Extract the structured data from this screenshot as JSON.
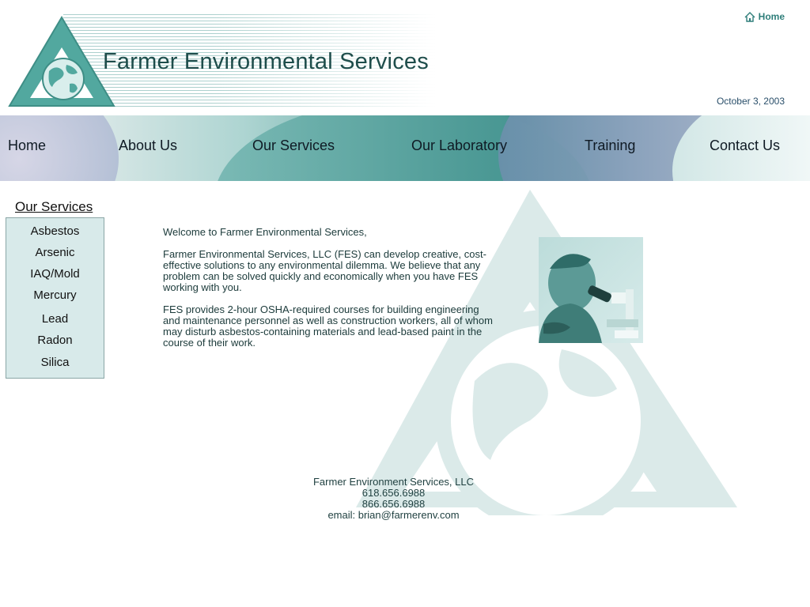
{
  "header": {
    "site_title": "Farmer Environmental Services",
    "home_link": "Home",
    "date": "October 3, 2003"
  },
  "nav": {
    "items": [
      {
        "label": "Home"
      },
      {
        "label": "About Us"
      },
      {
        "label": "Our Services"
      },
      {
        "label": "Our Laboratory"
      },
      {
        "label": "Training"
      },
      {
        "label": "Contact Us"
      }
    ]
  },
  "sidebar": {
    "heading": "Our Services",
    "items": [
      {
        "label": "Asbestos"
      },
      {
        "label": "Arsenic"
      },
      {
        "label": "IAQ/Mold"
      },
      {
        "label": "Mercury"
      },
      {
        "label": "Lead"
      },
      {
        "label": "Radon"
      },
      {
        "label": "Silica"
      }
    ]
  },
  "main": {
    "welcome": "Welcome to Farmer Environmental Services,",
    "paragraph1": "Farmer Environmental Services, LLC (FES) can develop creative, cost-effective solutions to any environmental dilemma. We believe that any problem can be solved quickly and economically when you have FES working with you.",
    "paragraph2": "FES provides 2-hour OSHA-required courses for building engineering and maintenance personnel as well as construction workers, all of whom may disturb asbestos-containing materials and lead-based paint in the course of their work."
  },
  "footer": {
    "company": "Farmer Environment Services, LLC",
    "phone1": "618.656.6988",
    "phone2": "866.656.6988",
    "email": "email: brian@farmerenv.com"
  },
  "colors": {
    "accent": "#3f8f8b",
    "title": "#1e4d4b",
    "sidebar_bg": "#d8eaea"
  },
  "icons": {
    "logo": "triangle-globe-logo",
    "home": "house-icon",
    "photo": "scientist-with-microscope-photo"
  }
}
